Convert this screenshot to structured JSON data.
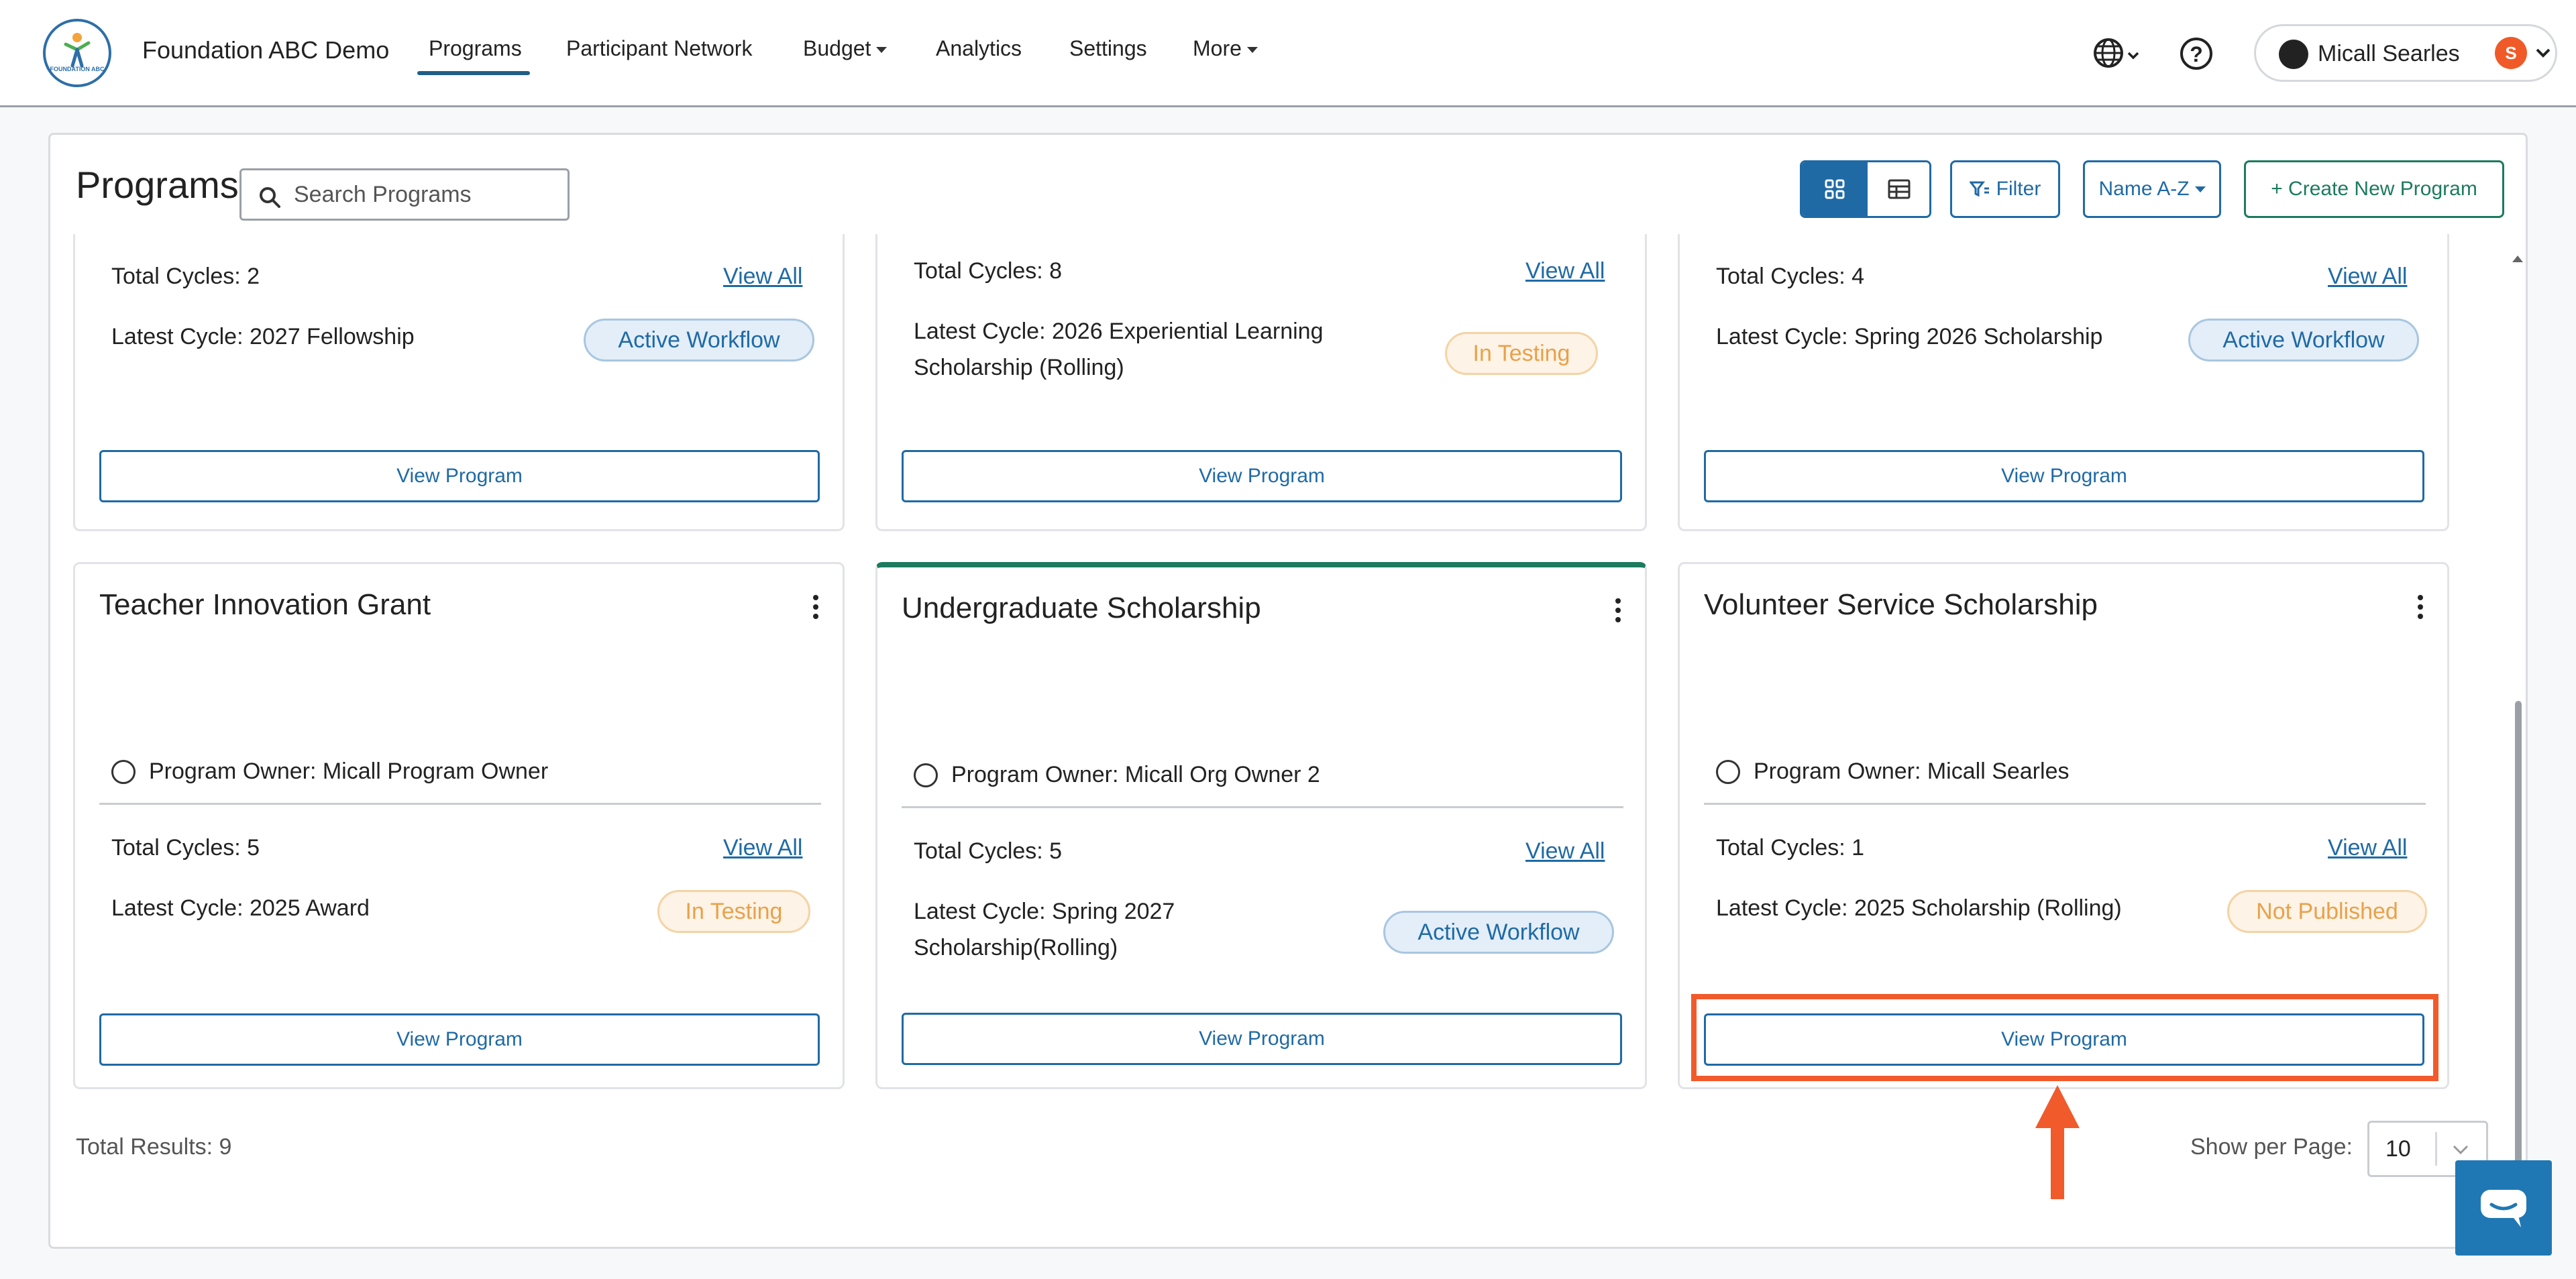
{
  "nav": {
    "logo_text": "FOUNDATION ABC",
    "org_name": "Foundation ABC Demo",
    "items": [
      {
        "label": "Programs",
        "active": true
      },
      {
        "label": "Participant Network"
      },
      {
        "label": "Budget",
        "dropdown": true
      },
      {
        "label": "Analytics"
      },
      {
        "label": "Settings"
      },
      {
        "label": "More",
        "dropdown": true
      }
    ],
    "user": {
      "name": "Micall Searles",
      "badge": "S"
    }
  },
  "page": {
    "title": "Programs",
    "search_placeholder": "Search Programs",
    "filter_label": "Filter",
    "sort_label": "Name A-Z",
    "create_label": "+ Create New Program"
  },
  "cards": [
    {
      "total_cycles": "Total Cycles: 2",
      "view_all": "View All",
      "latest_cycle": "Latest Cycle: 2027 Fellowship",
      "status": "Active Workflow",
      "view_program": "View Program"
    },
    {
      "total_cycles": "Total Cycles: 8",
      "view_all": "View All",
      "latest_cycle": "Latest Cycle: 2026 Experiential Learning Scholarship (Rolling)",
      "status": "In Testing",
      "view_program": "View Program"
    },
    {
      "total_cycles": "Total Cycles: 4",
      "view_all": "View All",
      "latest_cycle": "Latest Cycle: Spring 2026 Scholarship",
      "status": "Active Workflow",
      "view_program": "View Program"
    },
    {
      "title": "Teacher Innovation Grant",
      "owner": "Program Owner: Micall Program Owner",
      "total_cycles": "Total Cycles: 5",
      "view_all": "View All",
      "latest_cycle": "Latest Cycle: 2025 Award",
      "status": "In Testing",
      "view_program": "View Program"
    },
    {
      "title": "Undergraduate Scholarship",
      "owner": "Program Owner: Micall Org Owner 2",
      "total_cycles": "Total Cycles: 5",
      "view_all": "View All",
      "latest_cycle": "Latest Cycle: Spring 2027 Scholarship(Rolling)",
      "status": "Active Workflow",
      "view_program": "View Program"
    },
    {
      "title": "Volunteer Service Scholarship",
      "owner": "Program Owner: Micall Searles",
      "total_cycles": "Total Cycles: 1",
      "view_all": "View All",
      "latest_cycle": "Latest Cycle: 2025 Scholarship (Rolling)",
      "status": "Not Published",
      "view_program": "View Program"
    }
  ],
  "footer": {
    "total_results": "Total Results: 9",
    "per_page_label": "Show per Page:",
    "per_page_value": "10"
  },
  "colors": {
    "primary": "#1f6aa5",
    "accent_green": "#1c7a5f",
    "highlight": "#f15a2b",
    "chat": "#1f78b4"
  }
}
